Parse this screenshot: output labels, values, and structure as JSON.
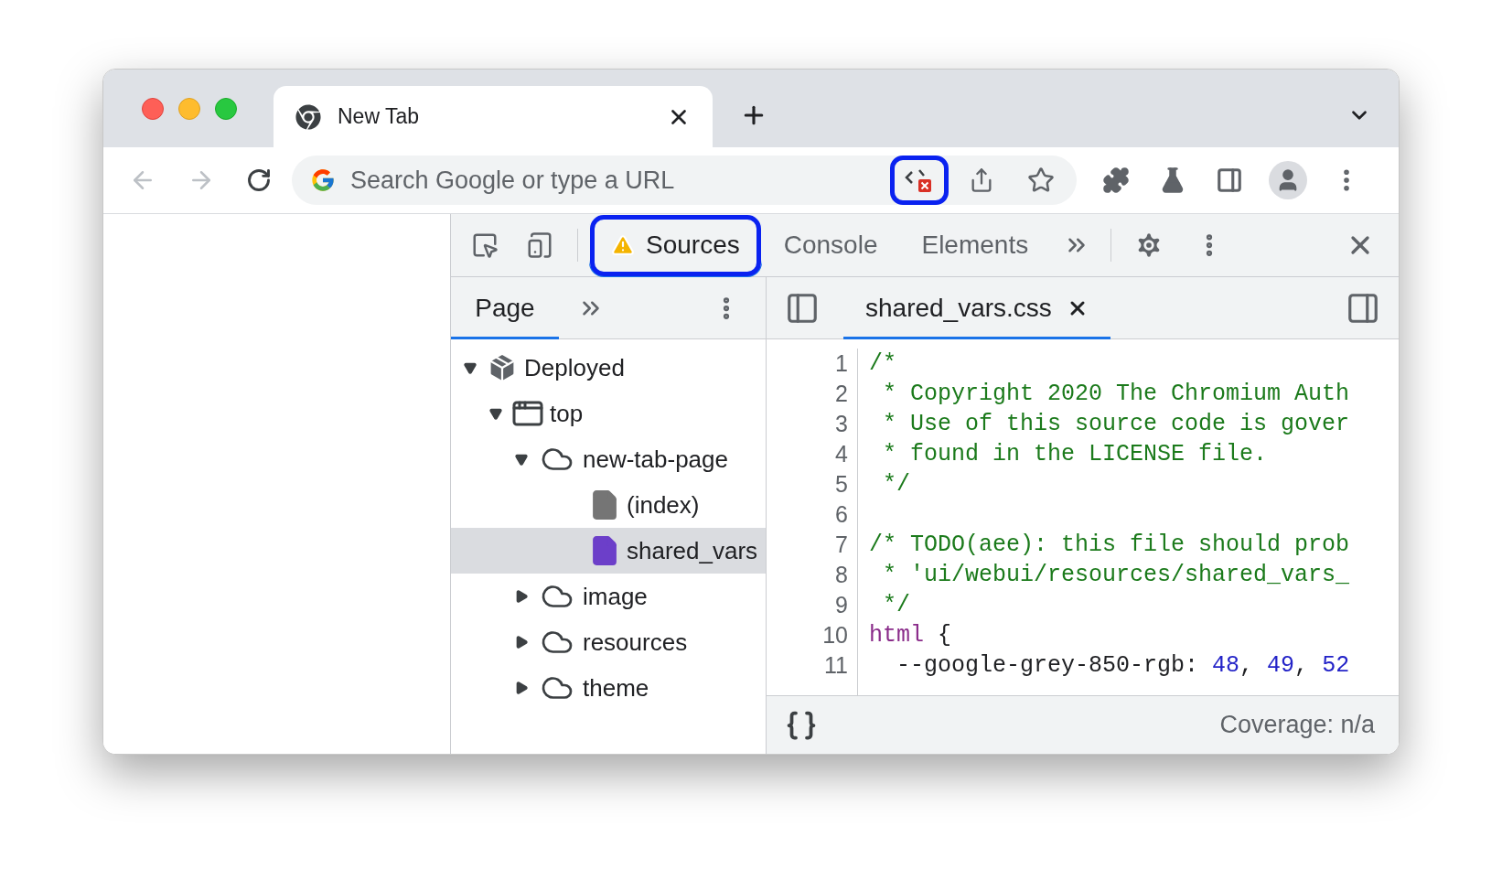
{
  "browser_tabs": [
    {
      "title": "New Tab",
      "selected": true
    }
  ],
  "omnibox": {
    "placeholder": "Search Google or type a URL",
    "devtools_action_highlighted": true
  },
  "devtools": {
    "tabs": [
      {
        "label": "Sources",
        "selected": true,
        "warning": true,
        "highlighted": true
      },
      {
        "label": "Console",
        "selected": false,
        "warning": false,
        "highlighted": false
      },
      {
        "label": "Elements",
        "selected": false,
        "warning": false,
        "highlighted": false
      }
    ],
    "navigator": {
      "tabs": [
        {
          "label": "Page",
          "selected": true
        }
      ],
      "tree": [
        {
          "label": "Deployed",
          "kind": "deployment",
          "expanded": true,
          "selected": false,
          "children": [
            {
              "label": "top",
              "kind": "frame",
              "expanded": true,
              "selected": false,
              "children": [
                {
                  "label": "new-tab-page",
                  "kind": "domain",
                  "expanded": true,
                  "selected": false,
                  "children": [
                    {
                      "label": "(index)",
                      "kind": "file",
                      "selected": false,
                      "color": "#757575"
                    },
                    {
                      "label": "shared_vars",
                      "kind": "file",
                      "selected": true,
                      "color": "#6c3fc9"
                    }
                  ]
                },
                {
                  "label": "image",
                  "kind": "domain",
                  "expanded": false,
                  "selected": false
                },
                {
                  "label": "resources",
                  "kind": "domain",
                  "expanded": false,
                  "selected": false
                },
                {
                  "label": "theme",
                  "kind": "domain",
                  "expanded": false,
                  "selected": false
                }
              ]
            }
          ]
        }
      ]
    },
    "editor": {
      "tabs": [
        {
          "label": "shared_vars.css",
          "selected": true
        }
      ],
      "lines": [
        {
          "number": "1",
          "tokens": [
            {
              "kind": "comment",
              "text": "/*"
            }
          ]
        },
        {
          "number": "2",
          "tokens": [
            {
              "kind": "comment",
              "text": " * Copyright 2020 The Chromium Auth"
            }
          ]
        },
        {
          "number": "3",
          "tokens": [
            {
              "kind": "comment",
              "text": " * Use of this source code is gover"
            }
          ]
        },
        {
          "number": "4",
          "tokens": [
            {
              "kind": "comment",
              "text": " * found in the LICENSE file."
            }
          ]
        },
        {
          "number": "5",
          "tokens": [
            {
              "kind": "comment",
              "text": " */"
            }
          ]
        },
        {
          "number": "6"
        },
        {
          "number": "7",
          "tokens": [
            {
              "kind": "comment",
              "text": "/* TODO(aee): this file should prob"
            }
          ]
        },
        {
          "number": "8",
          "tokens": [
            {
              "kind": "comment",
              "text": " * 'ui/webui/resources/shared_vars_"
            }
          ]
        },
        {
          "number": "9",
          "tokens": [
            {
              "kind": "comment",
              "text": " */"
            }
          ]
        },
        {
          "number": "10",
          "tokens": [
            {
              "kind": "keyword",
              "text": "html"
            },
            {
              "kind": "plain",
              "text": " {"
            }
          ]
        },
        {
          "number": "11",
          "tokens": [
            {
              "kind": "plain",
              "text": "  --google-grey-850-rgb: "
            },
            {
              "kind": "number",
              "text": "48"
            },
            {
              "kind": "plain",
              "text": ", "
            },
            {
              "kind": "number",
              "text": "49"
            },
            {
              "kind": "plain",
              "text": ", "
            },
            {
              "kind": "number",
              "text": "52"
            }
          ]
        }
      ]
    },
    "footer": {
      "coverage": "Coverage: n/a"
    }
  }
}
